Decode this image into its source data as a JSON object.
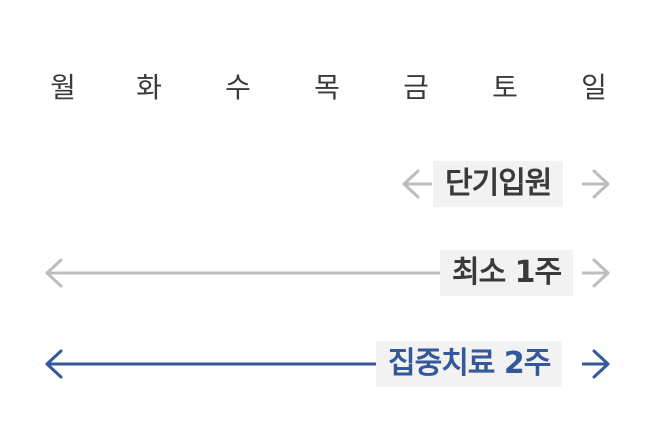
{
  "weekdays": [
    "월",
    "화",
    "수",
    "목",
    "금",
    "토",
    "일"
  ],
  "rows": [
    {
      "label": "단기입원",
      "color": "#bdbdbd",
      "text_color": "#3a3a3a",
      "span": "short"
    },
    {
      "label": "최소 1주",
      "color": "#bdbdbd",
      "text_color": "#3a3a3a",
      "span": "full"
    },
    {
      "label": "집중치료 2주",
      "color": "#34589a",
      "text_color": "#34589a",
      "span": "full"
    }
  ]
}
